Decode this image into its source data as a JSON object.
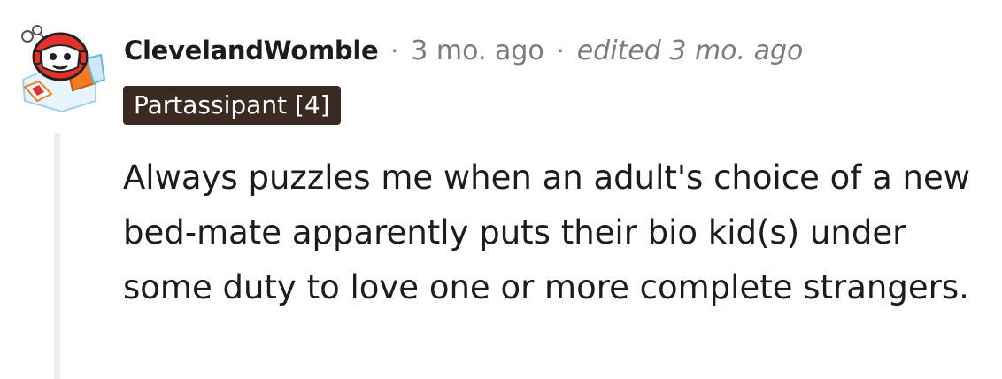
{
  "comment": {
    "author": "ClevelandWomble",
    "separator": "·",
    "timestamp": "3 mo. ago",
    "edited": "edited 3 mo. ago",
    "flair": "Partassipant [4]",
    "body": "Always puzzles me when an adult's choice of a new bed-mate apparently puts their bio kid(s) under some duty to love one or more complete strangers.",
    "avatar_icon": "snoo-avatar-icon"
  },
  "colors": {
    "flair_bg": "#3a2a22",
    "meta_text": "#7c7c7c",
    "thread_line": "#edeff1",
    "avatar_red": "#e4312b",
    "avatar_orange": "#f47b20"
  }
}
